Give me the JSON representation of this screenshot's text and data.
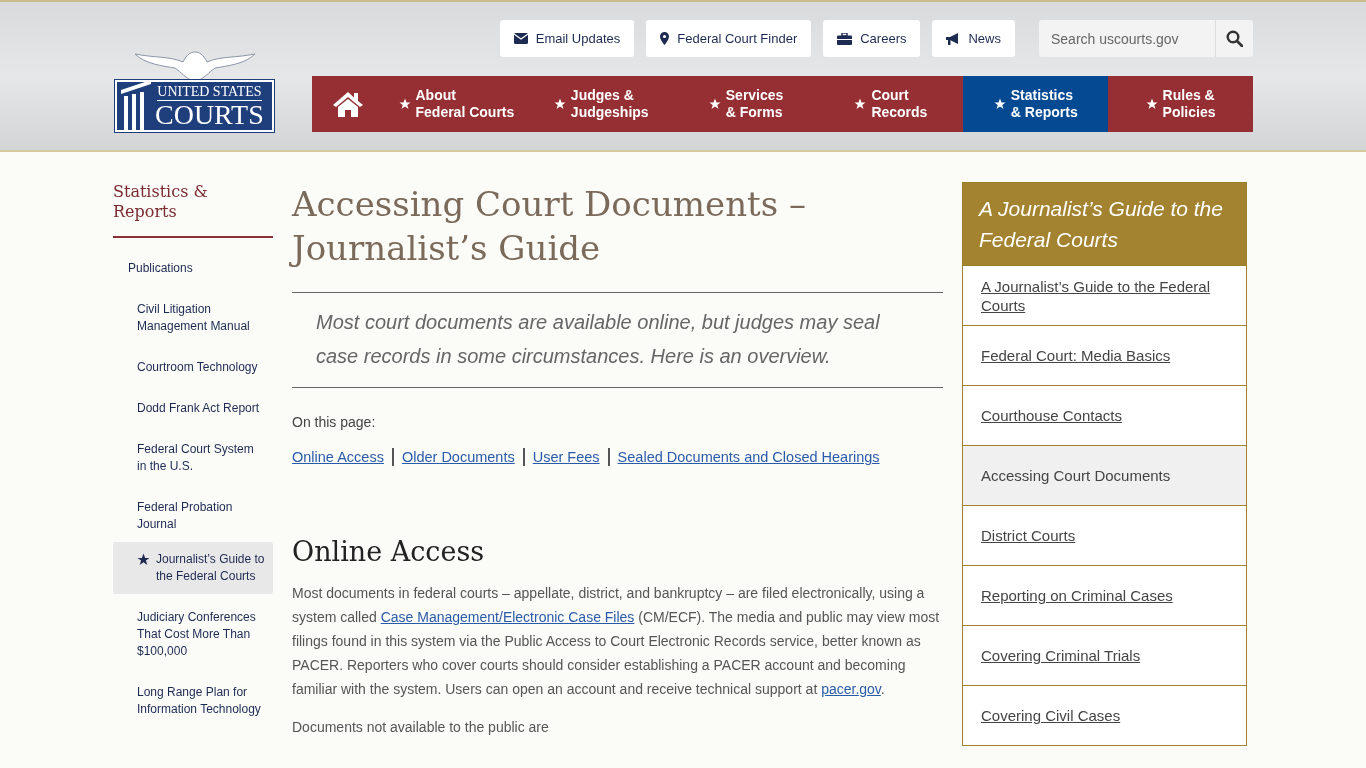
{
  "header": {
    "logo": {
      "line_1": "UNITED STATES",
      "line_2": "COURTS"
    },
    "utility_links": [
      {
        "label": "Email Updates",
        "kind": "envelope"
      },
      {
        "label": "Federal Court Finder",
        "kind": "pin"
      },
      {
        "label": "Careers",
        "kind": "briefcase"
      },
      {
        "label": "News",
        "kind": "megaphone"
      }
    ],
    "search": {
      "placeholder": "Search uscourts.gov"
    },
    "nav": [
      {
        "label_1": "About",
        "label_2": "Federal Courts",
        "selected": false
      },
      {
        "label_1": "Judges &",
        "label_2": "Judgeships",
        "selected": false
      },
      {
        "label_1": "Services",
        "label_2": "& Forms",
        "selected": false
      },
      {
        "label_1": "Court",
        "label_2": "Records",
        "selected": false
      },
      {
        "label_1": "Statistics",
        "label_2": "& Reports",
        "selected": true
      },
      {
        "label_1": "Rules &",
        "label_2": "Policies",
        "selected": false
      }
    ]
  },
  "sidebar": {
    "title": "Statistics & Reports",
    "items": [
      {
        "label": "Publications",
        "selected": false,
        "children": [
          {
            "label": "Civil Litigation Management Manual",
            "selected": false
          },
          {
            "label": "Courtroom Technology",
            "selected": false
          },
          {
            "label": "Dodd Frank Act Report",
            "selected": false
          },
          {
            "label": "Federal Court System in the U.S.",
            "selected": false
          },
          {
            "label": "Federal Probation Journal",
            "selected": false
          },
          {
            "label": "Journalist’s Guide to the Federal Courts",
            "selected": true
          },
          {
            "label": "Judiciary Conferences That Cost More Than $100,000",
            "selected": false
          },
          {
            "label": "Long Range Plan for Information Technology",
            "selected": false
          }
        ]
      }
    ]
  },
  "main": {
    "title": "Accessing Court Documents – Journalist’s Guide",
    "intro": "Most court documents are available online, but judges may seal case records in some circumstances. Here is an overview.",
    "on_this_page_label": "On this page:",
    "on_this_page_links": [
      "Online Access",
      "Older Documents",
      "User Fees",
      "Sealed Documents and Closed Hearings"
    ],
    "section_heading": "Online Access",
    "paragraphs": [
      [
        {
          "kind": "text",
          "text": "Most documents in federal courts – appellate, district, and bankruptcy – are filed electronically, using a system called "
        },
        {
          "kind": "link",
          "text": "Case Management/Electronic Case Files"
        },
        {
          "kind": "text",
          "text": " (CM/ECF). The media and public may view most filings found in this system via the Public Access to Court Electronic Records service, better known as PACER. Reporters who cover courts should consider establishing a PACER account and becoming familiar with the system. Users can open an account and receive technical support at "
        },
        {
          "kind": "link",
          "text": "pacer.gov"
        },
        {
          "kind": "text",
          "text": "."
        }
      ],
      [
        {
          "kind": "text",
          "text": "Documents not available to the public are"
        }
      ]
    ]
  },
  "guide": {
    "title": "A Journalist’s Guide to the Federal Courts",
    "items": [
      {
        "label": "A Journalist’s Guide to the Federal Courts",
        "selected": false
      },
      {
        "label": "Federal Court: Media Basics",
        "selected": false
      },
      {
        "label": "Courthouse Contacts",
        "selected": false
      },
      {
        "label": "Accessing Court Documents",
        "selected": true
      },
      {
        "label": "District Courts",
        "selected": false
      },
      {
        "label": "Reporting on Criminal Cases",
        "selected": false
      },
      {
        "label": "Covering Criminal Trials",
        "selected": false
      },
      {
        "label": "Covering Civil Cases",
        "selected": false
      }
    ]
  }
}
